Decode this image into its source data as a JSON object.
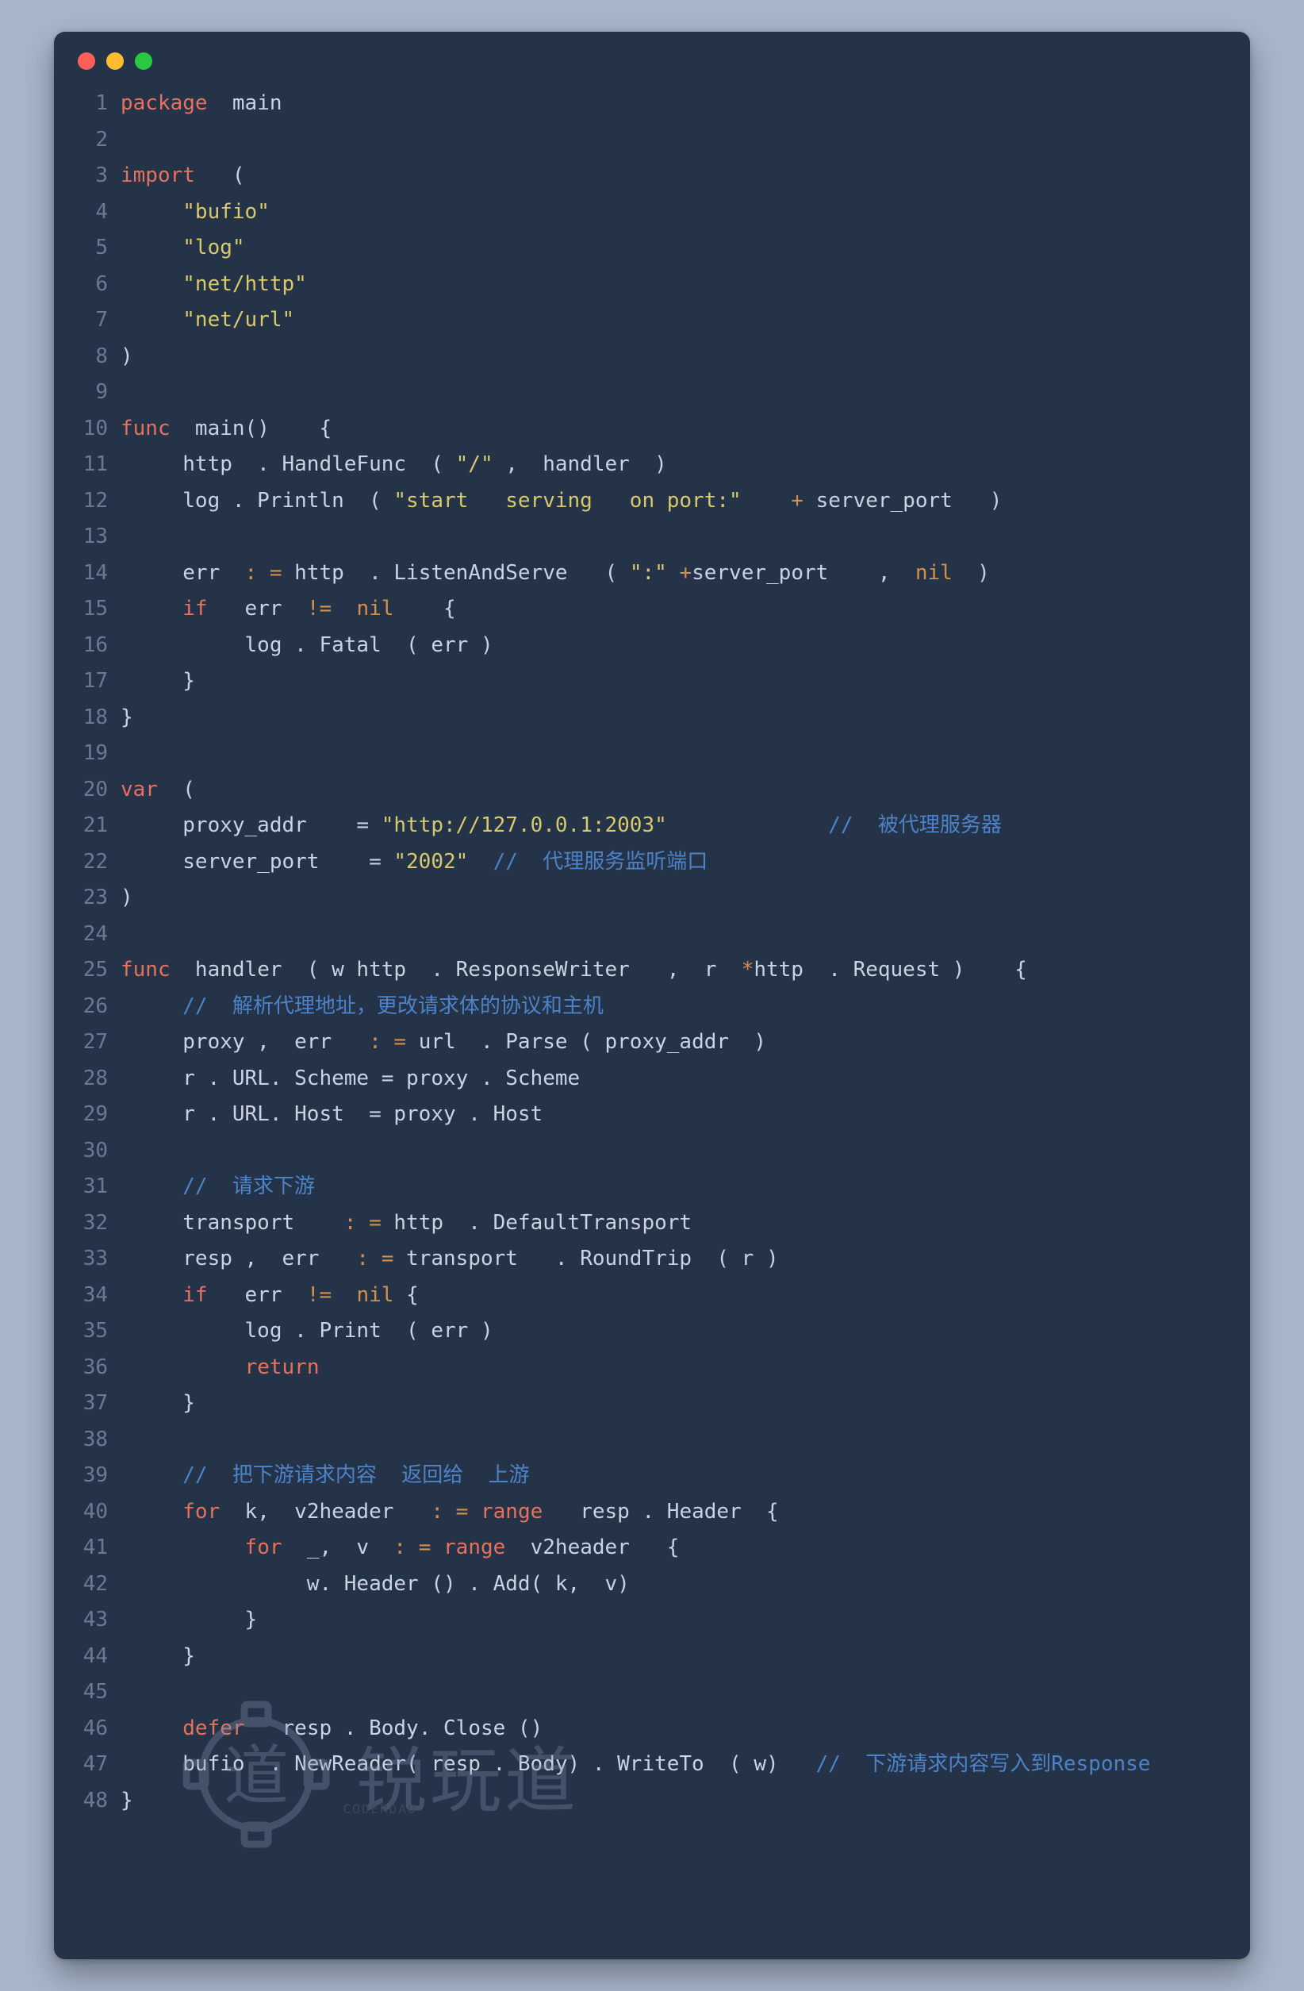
{
  "watermark": {
    "logo_char": "道",
    "text": "锐玩道",
    "small": "CODERDAO"
  },
  "lines": [
    {
      "n": 1,
      "tokens": [
        [
          "kw",
          "package"
        ],
        [
          "id",
          "  main"
        ]
      ]
    },
    {
      "n": 2,
      "tokens": []
    },
    {
      "n": 3,
      "tokens": [
        [
          "kw",
          "import"
        ],
        [
          "id",
          "   ("
        ]
      ]
    },
    {
      "n": 4,
      "tokens": [
        [
          "id",
          "     "
        ],
        [
          "str",
          "\"bufio\""
        ]
      ]
    },
    {
      "n": 5,
      "tokens": [
        [
          "id",
          "     "
        ],
        [
          "str",
          "\"log\""
        ]
      ]
    },
    {
      "n": 6,
      "tokens": [
        [
          "id",
          "     "
        ],
        [
          "str",
          "\"net/http\""
        ]
      ]
    },
    {
      "n": 7,
      "tokens": [
        [
          "id",
          "     "
        ],
        [
          "str",
          "\"net/url\""
        ]
      ]
    },
    {
      "n": 8,
      "tokens": [
        [
          "id",
          ")"
        ]
      ]
    },
    {
      "n": 9,
      "tokens": []
    },
    {
      "n": 10,
      "tokens": [
        [
          "kw",
          "func"
        ],
        [
          "id",
          "  main()    {"
        ]
      ]
    },
    {
      "n": 11,
      "tokens": [
        [
          "id",
          "     http  . HandleFunc  ( "
        ],
        [
          "str",
          "\"/\""
        ],
        [
          "id",
          " ,  handler  )"
        ]
      ]
    },
    {
      "n": 12,
      "tokens": [
        [
          "id",
          "     log . Println  ( "
        ],
        [
          "str",
          "\"start   serving   on port:\""
        ],
        [
          "id",
          "    "
        ],
        [
          "op",
          "+"
        ],
        [
          "id",
          " server_port   )"
        ]
      ]
    },
    {
      "n": 13,
      "tokens": []
    },
    {
      "n": 14,
      "tokens": [
        [
          "id",
          "     err  "
        ],
        [
          "op",
          ": ="
        ],
        [
          "id",
          " http  . ListenAndServe   ( "
        ],
        [
          "str",
          "\":\""
        ],
        [
          "id",
          " "
        ],
        [
          "op",
          "+"
        ],
        [
          "id",
          "server_port    ,  "
        ],
        [
          "op",
          "nil"
        ],
        [
          "id",
          "  )"
        ]
      ]
    },
    {
      "n": 15,
      "tokens": [
        [
          "id",
          "     "
        ],
        [
          "kw",
          "if"
        ],
        [
          "id",
          "   err  "
        ],
        [
          "op",
          "!="
        ],
        [
          "id",
          "  "
        ],
        [
          "op",
          "nil"
        ],
        [
          "id",
          "    {"
        ]
      ]
    },
    {
      "n": 16,
      "tokens": [
        [
          "id",
          "          log . Fatal  ( err )"
        ]
      ]
    },
    {
      "n": 17,
      "tokens": [
        [
          "id",
          "     }"
        ]
      ]
    },
    {
      "n": 18,
      "tokens": [
        [
          "id",
          "}"
        ]
      ]
    },
    {
      "n": 19,
      "tokens": []
    },
    {
      "n": 20,
      "tokens": [
        [
          "kw",
          "var"
        ],
        [
          "id",
          "  ("
        ]
      ]
    },
    {
      "n": 21,
      "tokens": [
        [
          "id",
          "     proxy_addr    = "
        ],
        [
          "str",
          "\"http://127.0.0.1:2003\""
        ],
        [
          "id",
          "             "
        ],
        [
          "cmt",
          "//  被代理服务器"
        ]
      ]
    },
    {
      "n": 22,
      "tokens": [
        [
          "id",
          "     server_port    = "
        ],
        [
          "str",
          "\"2002\""
        ],
        [
          "id",
          "  "
        ],
        [
          "cmt",
          "//  代理服务监听端口"
        ]
      ]
    },
    {
      "n": 23,
      "tokens": [
        [
          "id",
          ")"
        ]
      ]
    },
    {
      "n": 24,
      "tokens": []
    },
    {
      "n": 25,
      "tokens": [
        [
          "kw",
          "func"
        ],
        [
          "id",
          "  handler  ( w http  . ResponseWriter   ,  r  "
        ],
        [
          "op",
          "*"
        ],
        [
          "id",
          "http  . Request )    {"
        ]
      ]
    },
    {
      "n": 26,
      "tokens": [
        [
          "id",
          "     "
        ],
        [
          "cmt",
          "//  解析代理地址，更改请求体的协议和主机"
        ]
      ]
    },
    {
      "n": 27,
      "tokens": [
        [
          "id",
          "     proxy ,  err   "
        ],
        [
          "op",
          ": ="
        ],
        [
          "id",
          " url  . Parse ( proxy_addr  )"
        ]
      ]
    },
    {
      "n": 28,
      "tokens": [
        [
          "id",
          "     r . URL. Scheme = proxy . Scheme"
        ]
      ]
    },
    {
      "n": 29,
      "tokens": [
        [
          "id",
          "     r . URL. Host  = proxy . Host"
        ]
      ]
    },
    {
      "n": 30,
      "tokens": []
    },
    {
      "n": 31,
      "tokens": [
        [
          "id",
          "     "
        ],
        [
          "cmt",
          "//  请求下游"
        ]
      ]
    },
    {
      "n": 32,
      "tokens": [
        [
          "id",
          "     transport    "
        ],
        [
          "op",
          ": ="
        ],
        [
          "id",
          " http  . DefaultTransport"
        ]
      ]
    },
    {
      "n": 33,
      "tokens": [
        [
          "id",
          "     resp ,  err   "
        ],
        [
          "op",
          ": ="
        ],
        [
          "id",
          " transport   . RoundTrip  ( r )"
        ]
      ]
    },
    {
      "n": 34,
      "tokens": [
        [
          "id",
          "     "
        ],
        [
          "kw",
          "if"
        ],
        [
          "id",
          "   err  "
        ],
        [
          "op",
          "!="
        ],
        [
          "id",
          "  "
        ],
        [
          "op",
          "nil"
        ],
        [
          "id",
          " {"
        ]
      ]
    },
    {
      "n": 35,
      "tokens": [
        [
          "id",
          "          log . Print  ( err )"
        ]
      ]
    },
    {
      "n": 36,
      "tokens": [
        [
          "id",
          "          "
        ],
        [
          "kw",
          "return"
        ]
      ]
    },
    {
      "n": 37,
      "tokens": [
        [
          "id",
          "     }"
        ]
      ]
    },
    {
      "n": 38,
      "tokens": []
    },
    {
      "n": 39,
      "tokens": [
        [
          "id",
          "     "
        ],
        [
          "cmt",
          "//  把下游请求内容  返回给  上游"
        ]
      ]
    },
    {
      "n": 40,
      "tokens": [
        [
          "id",
          "     "
        ],
        [
          "kw",
          "for"
        ],
        [
          "id",
          "  k,  v2header   "
        ],
        [
          "op",
          ": ="
        ],
        [
          "id",
          " "
        ],
        [
          "kw",
          "range"
        ],
        [
          "id",
          "   resp . Header  {"
        ]
      ]
    },
    {
      "n": 41,
      "tokens": [
        [
          "id",
          "          "
        ],
        [
          "kw",
          "for"
        ],
        [
          "id",
          "  _,  v  "
        ],
        [
          "op",
          ": ="
        ],
        [
          "id",
          " "
        ],
        [
          "kw",
          "range"
        ],
        [
          "id",
          "  v2header   {"
        ]
      ]
    },
    {
      "n": 42,
      "tokens": [
        [
          "id",
          "               w. Header () . Add( k,  v)"
        ]
      ]
    },
    {
      "n": 43,
      "tokens": [
        [
          "id",
          "          }"
        ]
      ]
    },
    {
      "n": 44,
      "tokens": [
        [
          "id",
          "     }"
        ]
      ]
    },
    {
      "n": 45,
      "tokens": []
    },
    {
      "n": 46,
      "tokens": [
        [
          "id",
          "     "
        ],
        [
          "kw",
          "defer"
        ],
        [
          "id",
          "   resp . Body. Close ()"
        ]
      ]
    },
    {
      "n": 47,
      "tokens": [
        [
          "id",
          "     bufio  . NewReader( resp . Body) . WriteTo  ( w)   "
        ],
        [
          "cmt",
          "//  下游请求内容写入到Response"
        ]
      ]
    },
    {
      "n": 48,
      "tokens": [
        [
          "id",
          "}"
        ]
      ]
    }
  ]
}
